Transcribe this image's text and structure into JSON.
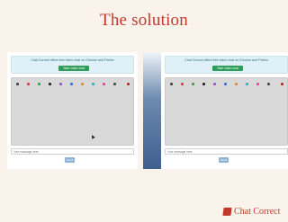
{
  "slide": {
    "title": "The solution"
  },
  "left_panel": {
    "banner_text": "Chat Correct offers free video chat on Chrome and Firefox",
    "start_button": "Start video chat",
    "message_placeholder": "Your message here",
    "send_button": "Send"
  },
  "right_panel": {
    "banner_text": "Chat Correct offers free video chat on Chrome and Firefox",
    "start_button": "Start video chat",
    "message_placeholder": "Your message here",
    "send_button": "Send"
  },
  "swatch_colors": [
    "#444444",
    "#e03b3b",
    "#3aa04a",
    "#222222",
    "#9b4fc9",
    "#3b6fd8",
    "#e08a2a",
    "#2ab0c0",
    "#d94a9a",
    "#4a4a4a",
    "#b02a2a"
  ],
  "brand": {
    "name": "Chat Correct",
    "color": "#c0392b"
  }
}
